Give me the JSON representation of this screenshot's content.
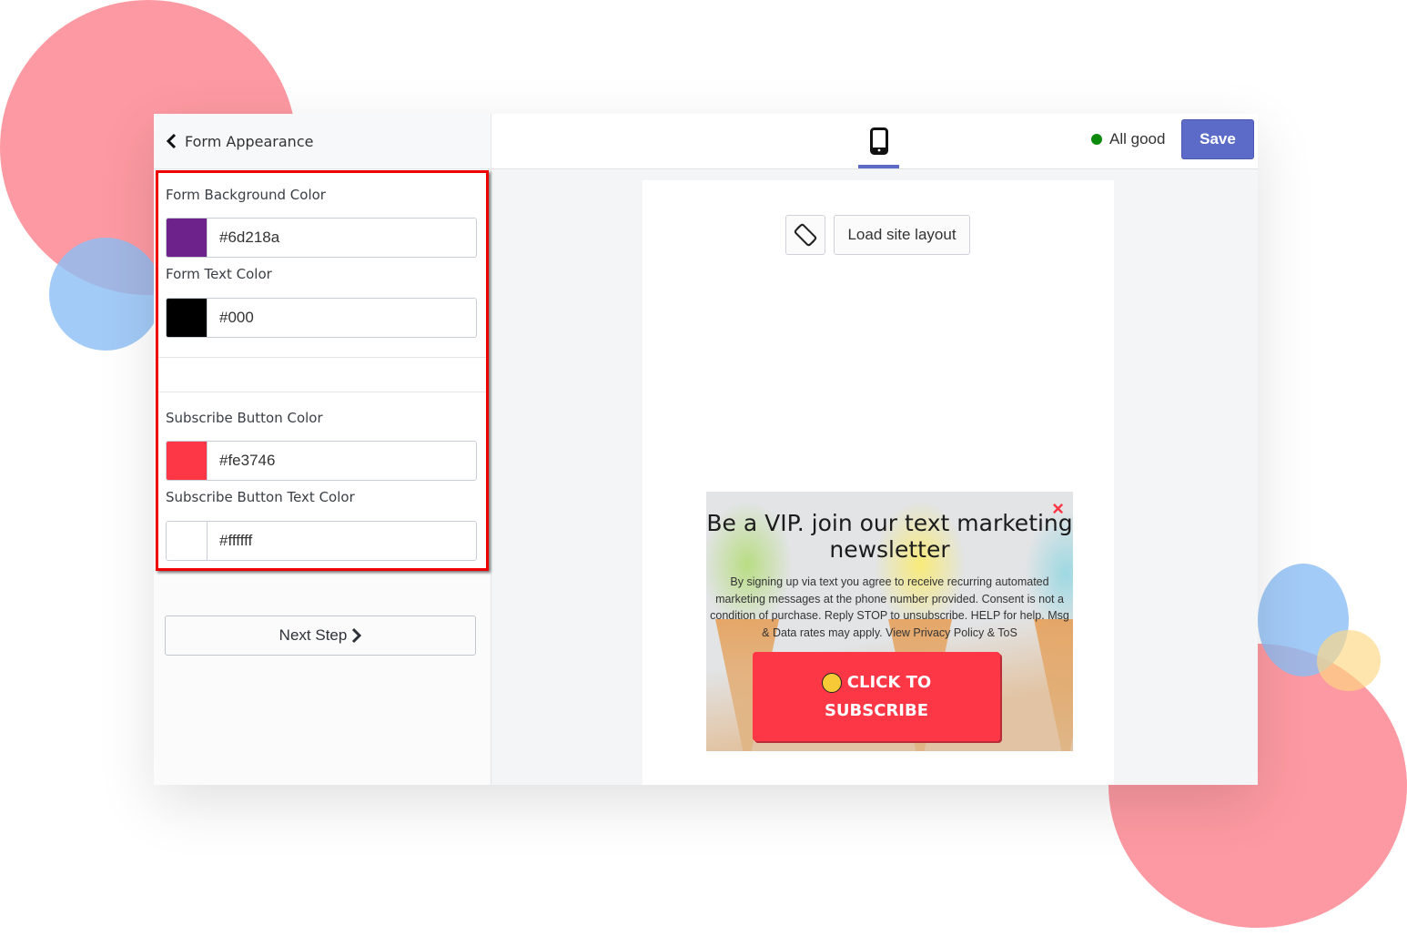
{
  "sidebar": {
    "title": "Form Appearance",
    "fields": [
      {
        "label": "Form Background Color",
        "value": "#6d218a",
        "swatch": "#6d218a"
      },
      {
        "label": "Form Text Color",
        "value": "#000",
        "swatch": "#000000"
      },
      {
        "label": "Subscribe Button Color",
        "value": "#fe3746",
        "swatch": "#fe3746"
      },
      {
        "label": "Subscribe Button Text Color",
        "value": "#ffffff",
        "swatch": "#ffffff"
      }
    ],
    "next_label": "Next Step"
  },
  "topbar": {
    "status_text": "All good",
    "status_color": "#0b8a0b",
    "save_label": "Save",
    "accent": "#5b6bc7"
  },
  "preview": {
    "load_layout_label": "Load site layout",
    "popup": {
      "close": "×",
      "title": "Be a VIP. join our text marketing newsletter",
      "legal": "By signing up via text you agree to receive recurring automated marketing messages at the phone number provided. Consent is not a condition of purchase. Reply STOP to unsubscribe. HELP for help. Msg & Data rates may apply. View Privacy Policy & ToS",
      "cta_line1": "CLICK TO",
      "cta_line2": "SUBSCRIBE",
      "cta_color": "#fe3746"
    }
  }
}
